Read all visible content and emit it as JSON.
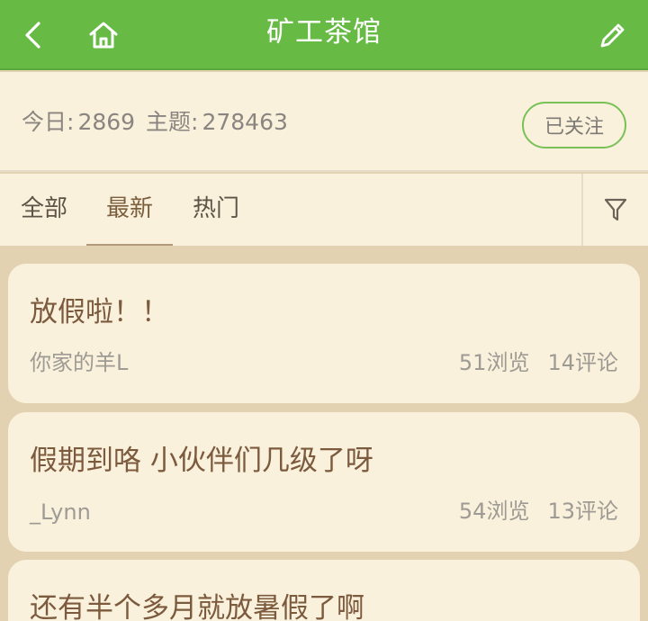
{
  "header": {
    "title": "矿工茶馆",
    "icons": {
      "back": "chevron-left-icon",
      "home": "home-icon",
      "edit": "pencil-icon"
    }
  },
  "info": {
    "today_label": "今日:",
    "today_value": "2869",
    "topics_label": "主题:",
    "topics_value": "278463",
    "follow_label": "已关注"
  },
  "tabs": [
    {
      "label": "全部"
    },
    {
      "label": "最新",
      "active": true
    },
    {
      "label": "热门"
    }
  ],
  "filter_icon": "filter-icon",
  "posts": [
    {
      "title": "放假啦！！",
      "author": "你家的羊L",
      "views": "51浏览",
      "comments": "14评论"
    },
    {
      "title": "假期到咯 小伙伴们几级了呀",
      "author": "_Lynn",
      "views": "54浏览",
      "comments": "13评论"
    },
    {
      "title": "还有半个多月就放暑假了啊"
    }
  ],
  "colors": {
    "header_bg": "#67bb45",
    "panel_bg": "#faf1dc",
    "page_bg": "#e2d2b2",
    "title_text": "#7c5a3e",
    "muted_text": "#9e9a94"
  }
}
